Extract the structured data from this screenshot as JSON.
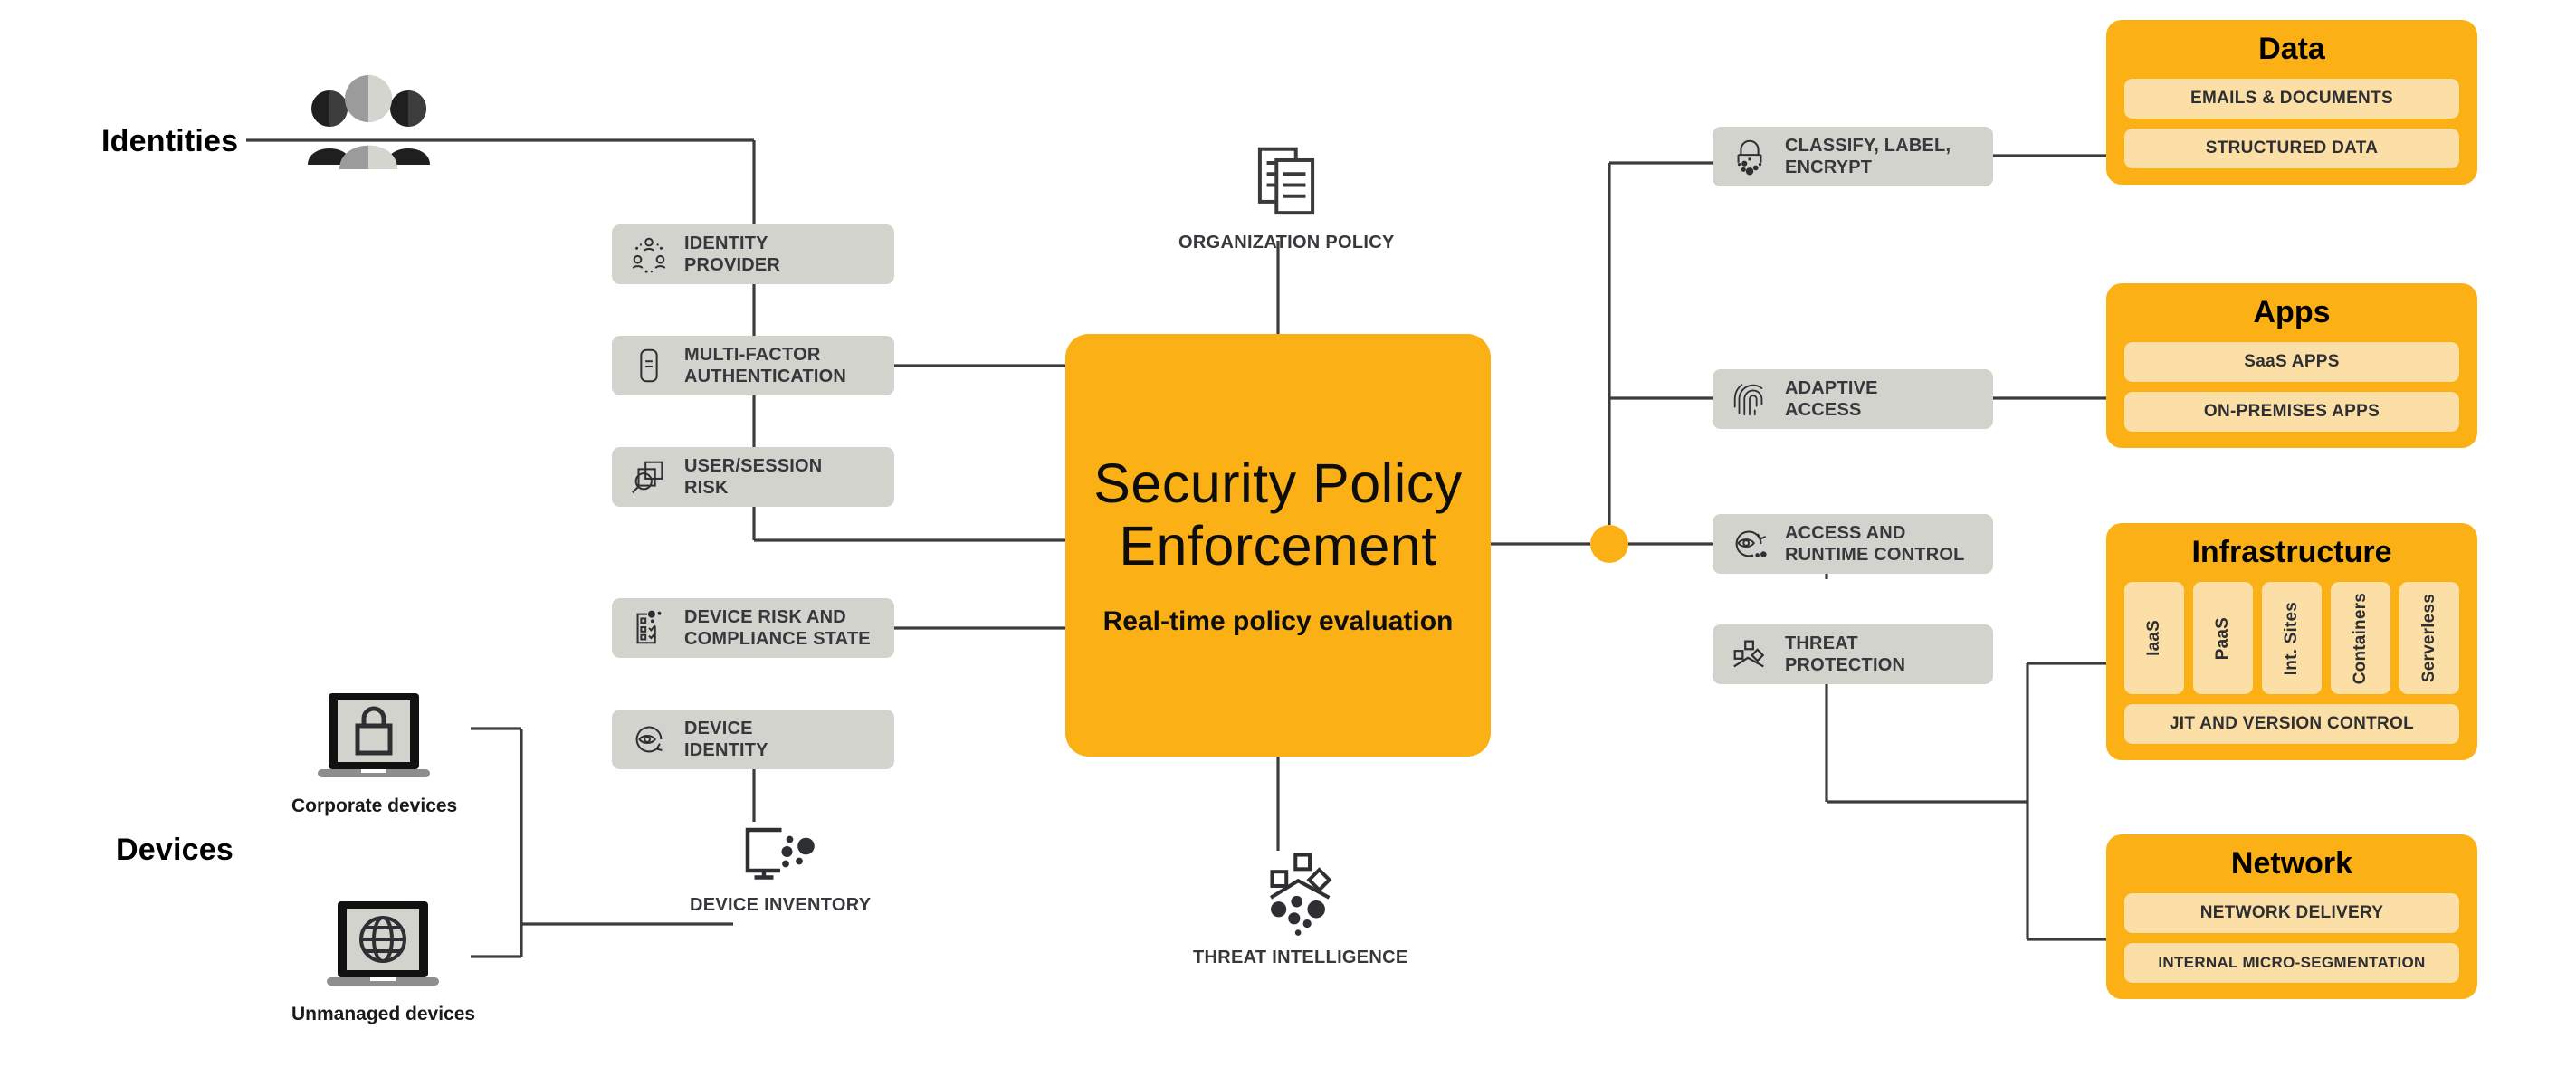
{
  "sections": {
    "identities_label": "Identities",
    "devices_label": "Devices"
  },
  "signals": {
    "identity": [
      {
        "name": "identity-provider",
        "label": "IDENTITY\nPROVIDER",
        "icon": "people-network-icon"
      },
      {
        "name": "multi-factor-authentication",
        "label": "MULTI-FACTOR\nAUTHENTICATION",
        "icon": "mobile-token-icon"
      },
      {
        "name": "user-session-risk",
        "label": "USER/SESSION\nRISK",
        "icon": "magnifier-windows-icon"
      }
    ],
    "device": [
      {
        "name": "device-risk-and-compliance-state",
        "label": "DEVICE RISK AND\nCOMPLIANCE STATE",
        "icon": "checklist-icon"
      },
      {
        "name": "device-identity",
        "label": "DEVICE\nIDENTITY",
        "icon": "eye-refresh-icon"
      }
    ]
  },
  "endpoints": [
    {
      "name": "corporate-devices",
      "label": "Corporate devices",
      "icon": "laptop-lock-icon"
    },
    {
      "name": "unmanaged-devices",
      "label": "Unmanaged devices",
      "icon": "laptop-globe-icon"
    }
  ],
  "inputs": {
    "device_inventory": {
      "label": "DEVICE INVENTORY",
      "icon": "monitor-dots-icon"
    },
    "organization_policy": {
      "label": "ORGANIZATION POLICY",
      "icon": "documents-icon"
    },
    "threat_intelligence": {
      "label": "THREAT INTELLIGENCE",
      "icon": "threat-scatter-icon"
    }
  },
  "hub": {
    "title": "Security\nPolicy\nEnforcement",
    "subtitle": "Real-time\npolicy evaluation",
    "color": "#FBB016"
  },
  "controls": [
    {
      "name": "classify-label-encrypt",
      "label": "CLASSIFY, LABEL,\nENCRYPT",
      "icon": "lock-dots-icon"
    },
    {
      "name": "adaptive-access",
      "label": "ADAPTIVE\nACCESS",
      "icon": "fingerprint-icon"
    },
    {
      "name": "access-and-runtime-control",
      "label": "ACCESS AND\nRUNTIME CONTROL",
      "icon": "eye-refresh-dots-icon"
    },
    {
      "name": "threat-protection",
      "label": "THREAT\nPROTECTION",
      "icon": "threat-shapes-icon"
    }
  ],
  "estate": [
    {
      "name": "data",
      "title": "Data",
      "items": [
        "EMAILS & DOCUMENTS",
        "STRUCTURED DATA"
      ],
      "vertical_items": []
    },
    {
      "name": "apps",
      "title": "Apps",
      "items": [
        "SaaS APPS",
        "ON-PREMISES APPS"
      ],
      "vertical_items": []
    },
    {
      "name": "infrastructure",
      "title": "Infrastructure",
      "items": [
        "JIT AND VERSION CONTROL"
      ],
      "vertical_items": [
        "IaaS",
        "PaaS",
        "Int. Sites",
        "Containers",
        "Serverless"
      ]
    },
    {
      "name": "network",
      "title": "Network",
      "items": [
        "NETWORK DELIVERY",
        "INTERNAL MICRO-SEGMENTATION"
      ],
      "vertical_items": []
    }
  ],
  "colors": {
    "orange": "#FBB016",
    "pill": "#FCDFA6",
    "grey_box": "#d2d3cd",
    "wire": "#3c3c3c",
    "text_dark": "#36383b"
  }
}
